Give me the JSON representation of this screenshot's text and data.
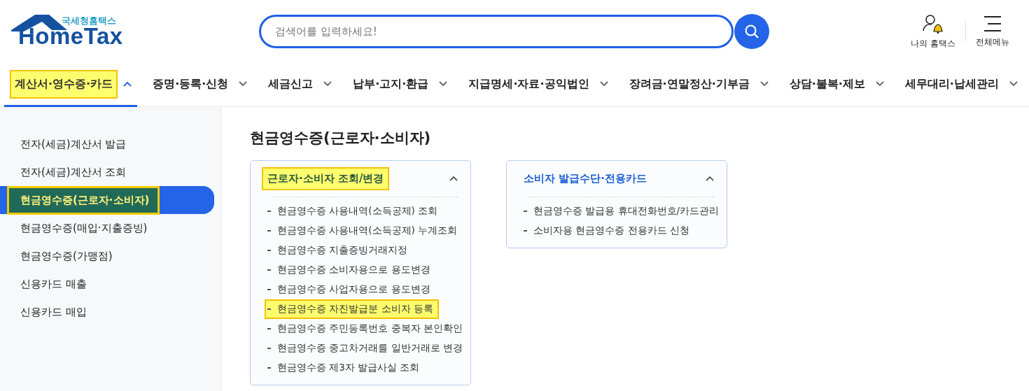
{
  "logo": {
    "subtitle": "국세청홈택스",
    "name": "HomeTax"
  },
  "search": {
    "placeholder": "검색어를 입력하세요!"
  },
  "header_links": [
    {
      "label": "나의 홈택스",
      "kind": "user"
    },
    {
      "label": "전체메뉴",
      "kind": "menu"
    }
  ],
  "nav": [
    {
      "label": "계산서·영수증·카드",
      "selected": true,
      "highlighted": true
    },
    {
      "label": "증명·등록·신청",
      "selected": false,
      "highlighted": false
    },
    {
      "label": "세금신고",
      "selected": false,
      "highlighted": false
    },
    {
      "label": "납부·고지·환급",
      "selected": false,
      "highlighted": false
    },
    {
      "label": "지급명세·자료·공익법인",
      "selected": false,
      "highlighted": false
    },
    {
      "label": "장려금·연말정산·기부금",
      "selected": false,
      "highlighted": false
    },
    {
      "label": "상담·불복·제보",
      "selected": false,
      "highlighted": false
    },
    {
      "label": "세무대리·납세관리",
      "selected": false,
      "highlighted": false
    }
  ],
  "sidebar": {
    "items": [
      {
        "label": "전자(세금)계산서 발급",
        "selected": false,
        "highlighted": false
      },
      {
        "label": "전자(세금)계산서 조회",
        "selected": false,
        "highlighted": false
      },
      {
        "label": "현금영수증(근로자·소비자)",
        "selected": true,
        "highlighted": true
      },
      {
        "label": "현금영수증(매입·지출증빙)",
        "selected": false,
        "highlighted": false
      },
      {
        "label": "현금영수증(가맹점)",
        "selected": false,
        "highlighted": false
      },
      {
        "label": "신용카드 매출",
        "selected": false,
        "highlighted": false
      },
      {
        "label": "신용카드 매입",
        "selected": false,
        "highlighted": false
      }
    ]
  },
  "page_title": "현금영수증(근로자·소비자)",
  "cards": [
    {
      "title": "근로자·소비자 조회/변경",
      "expanded": true,
      "highlighted": true,
      "items": [
        {
          "label": "현금영수증 사용내역(소득공제) 조회",
          "highlighted": false
        },
        {
          "label": "현금영수증 사용내역(소득공제) 누계조회",
          "highlighted": false
        },
        {
          "label": "현금영수증 지출증빙거래지정",
          "highlighted": false
        },
        {
          "label": "현금영수증 소비자용으로 용도변경",
          "highlighted": false
        },
        {
          "label": "현금영수증 사업자용으로 용도변경",
          "highlighted": false
        },
        {
          "label": "현금영수증 자진발급분 소비자 등록",
          "highlighted": true
        },
        {
          "label": "현금영수증 주민등록번호 중복자 본인확인",
          "highlighted": false
        },
        {
          "label": "현금영수증 중고차거래를 일반거래로 변경",
          "highlighted": false
        },
        {
          "label": "현금영수증 제3자 발급사실 조회",
          "highlighted": false
        }
      ]
    },
    {
      "title": "소비자 발급수단·전용카드",
      "expanded": true,
      "highlighted": false,
      "items": [
        {
          "label": "현금영수증 발급용 휴대전화번호/카드관리",
          "highlighted": false
        },
        {
          "label": "소비자용 현금영수증 전용카드 신청",
          "highlighted": false
        }
      ]
    }
  ]
}
